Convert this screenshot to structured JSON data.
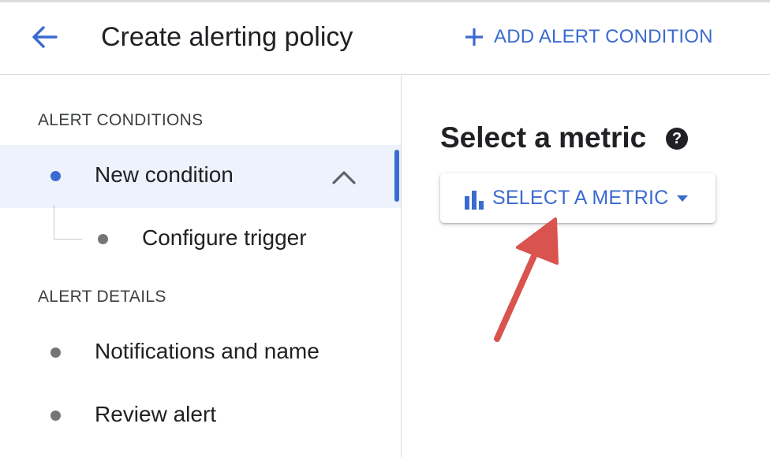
{
  "header": {
    "back_icon": "arrow-back-icon",
    "title": "Create alerting policy",
    "add_condition_icon": "plus-icon",
    "add_condition_label": "ADD ALERT CONDITION"
  },
  "sidebar": {
    "conditions_heading": "ALERT CONDITIONS",
    "new_condition_label": "New condition",
    "configure_trigger_label": "Configure trigger",
    "details_heading": "ALERT DETAILS",
    "notifications_label": "Notifications and name",
    "review_label": "Review alert"
  },
  "main": {
    "title": "Select a metric",
    "help_glyph": "?",
    "select_metric_label": "SELECT A METRIC",
    "select_metric_icon": "bar-chart-icon"
  },
  "colors": {
    "accent": "#3b6bd0",
    "active_bg": "#eef2fc",
    "annotation_arrow": "#d9534f"
  }
}
